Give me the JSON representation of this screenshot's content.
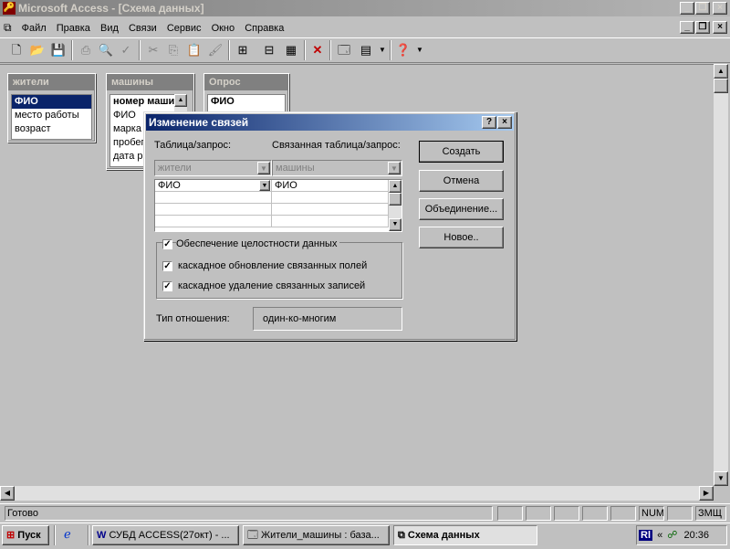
{
  "app": {
    "title": "Microsoft Access - [Схема данных]",
    "menu": [
      "Файл",
      "Правка",
      "Вид",
      "Связи",
      "Сервис",
      "Окно",
      "Справка"
    ]
  },
  "tables": [
    {
      "title": "жители",
      "fields": [
        "ФИО",
        "место работы",
        "возраст"
      ]
    },
    {
      "title": "машины",
      "fields": [
        "номер машины",
        "ФИО",
        "марка",
        "пробег",
        "дата р"
      ]
    },
    {
      "title": "Опрос",
      "fields": [
        "ФИО"
      ]
    }
  ],
  "dialog": {
    "title": "Изменение связей",
    "table_label": "Таблица/запрос:",
    "related_label": "Связанная таблица/запрос:",
    "table_value": "жители",
    "related_value": "машины",
    "field_left": "ФИО",
    "field_right": "ФИО",
    "integrity": "Обеспечение целостности данных",
    "cascade_update": "каскадное обновление связанных полей",
    "cascade_delete": "каскадное удаление связанных записей",
    "relation_type_label": "Тип отношения:",
    "relation_type_value": "один-ко-многим",
    "buttons": {
      "create": "Создать",
      "cancel": "Отмена",
      "join": "Объединение...",
      "new": "Новое.."
    }
  },
  "status": {
    "text": "Готово",
    "num": "NUM",
    "zmsh": "ЗМЩ"
  },
  "taskbar": {
    "start": "Пуск",
    "tasks": [
      "СУБД ACCESS(27окт) - ...",
      "Жители_машины : база...",
      "Схема данных"
    ],
    "lang": "Rl",
    "time": "20:36"
  },
  "colors": {
    "active_title": "#0a246a",
    "inactive_title": "#808080",
    "desktop": "#c0c0c0"
  }
}
